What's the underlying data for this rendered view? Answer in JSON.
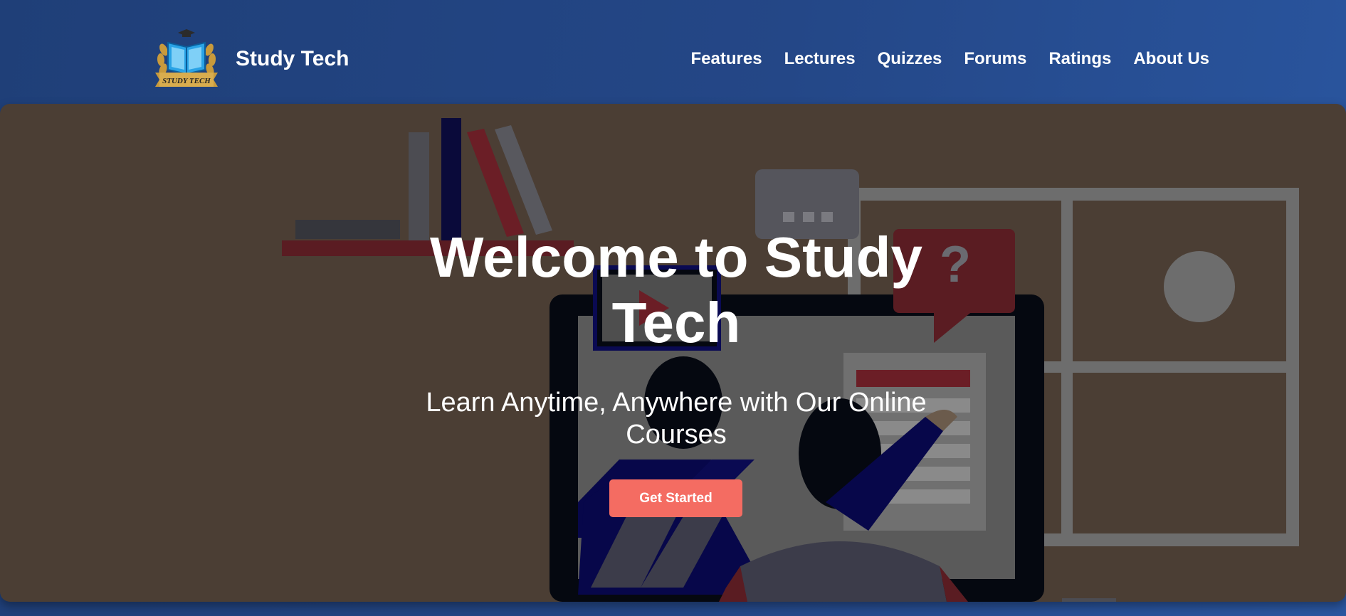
{
  "header": {
    "logo_alt": "Study Tech",
    "logo_text": "STUDY TECH",
    "brand": "Study Tech",
    "nav": [
      {
        "label": "Features"
      },
      {
        "label": "Lectures"
      },
      {
        "label": "Quizzes"
      },
      {
        "label": "Forums"
      },
      {
        "label": "Ratings"
      },
      {
        "label": "About Us"
      }
    ]
  },
  "hero": {
    "title": "Welcome to Study Tech",
    "subtitle": "Learn Anytime, Anywhere with Our Online Courses",
    "cta_label": "Get Started",
    "illustration_icons": [
      "bookshelf-icon",
      "monitor-icon",
      "video-play-icon",
      "speech-bubble-icon",
      "question-icon",
      "window-grid-icon",
      "teacher-icon",
      "student-icon"
    ]
  },
  "colors": {
    "header_bg": "#244787",
    "hero_overlay": "#4b3e34",
    "cta_bg": "#f46c62",
    "text": "#ffffff"
  }
}
